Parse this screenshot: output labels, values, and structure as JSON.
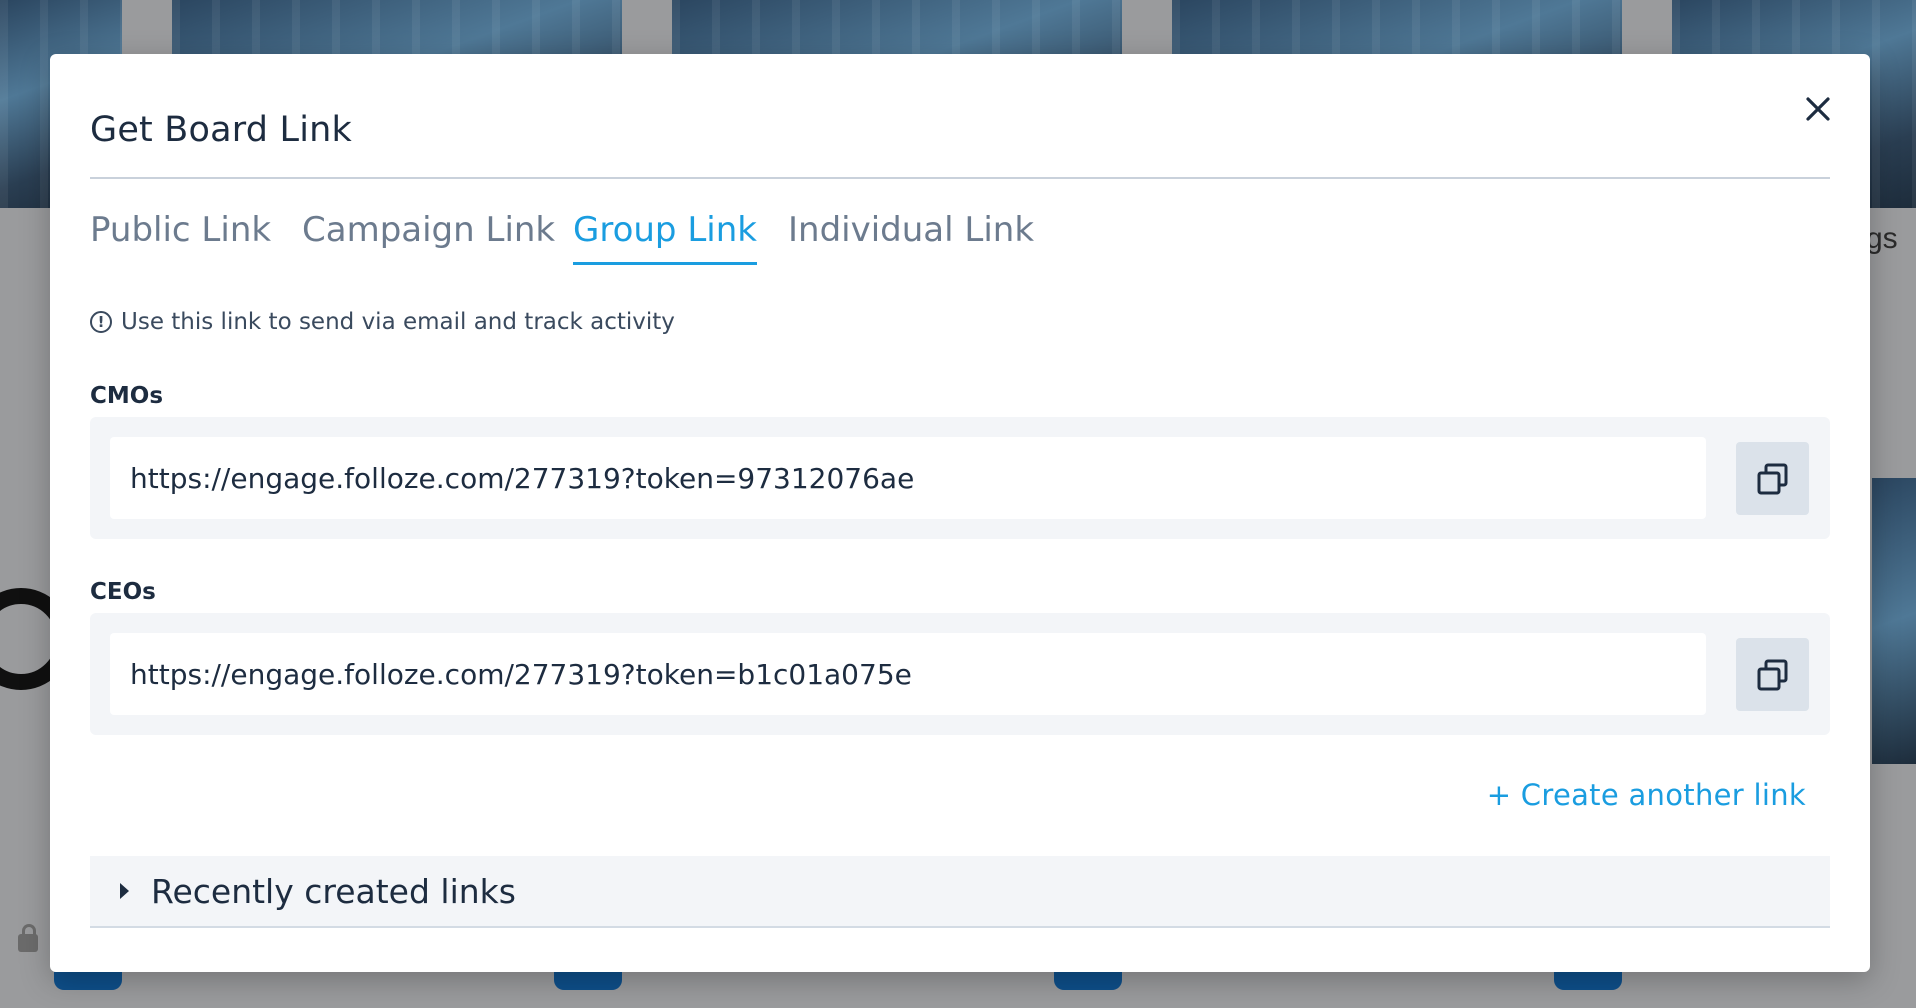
{
  "background": {
    "side_text": "gs"
  },
  "modal": {
    "title": "Get Board Link",
    "close_label": "Close",
    "tabs": [
      {
        "label": "Public Link",
        "active": false
      },
      {
        "label": "Campaign Link",
        "active": false
      },
      {
        "label": "Group Link",
        "active": true
      },
      {
        "label": "Individual Link",
        "active": false
      }
    ],
    "info_text": "Use this link to send via email and track activity",
    "groups": [
      {
        "label": "CMOs",
        "url": "https://engage.folloze.com/277319?token=97312076ae"
      },
      {
        "label": "CEOs",
        "url": "https://engage.folloze.com/277319?token=b1c01a075e"
      }
    ],
    "create_link_label": "+ Create another link",
    "recent_label": "Recently created links"
  },
  "colors": {
    "accent": "#1a9de0",
    "text_dark": "#1d2c40",
    "tab_inactive": "#6c7b8e",
    "panel_bg": "#f3f5f8",
    "copy_btn_bg": "#dbe2ea"
  }
}
